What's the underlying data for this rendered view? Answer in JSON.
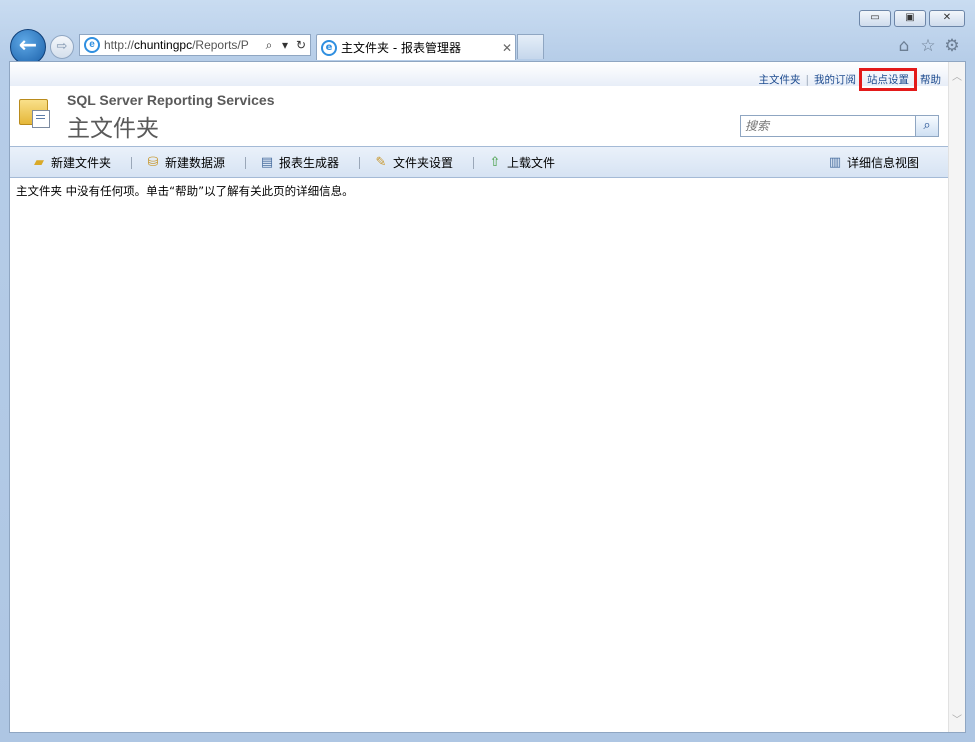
{
  "browser": {
    "address": {
      "prefix": "http://",
      "host": "chuntingpc",
      "path": "/Reports/P"
    },
    "tab_title": "主文件夹 - 报表管理器",
    "icons": [
      "back-arrow-icon",
      "forward-arrow-icon",
      "ie-logo-icon",
      "search-icon",
      "dropdown-icon",
      "refresh-icon",
      "close-icon",
      "home-icon",
      "star-icon",
      "gear-icon",
      "minimize-icon",
      "maximize-icon"
    ]
  },
  "toplinks": {
    "home": "主文件夹",
    "subscriptions": "我的订阅",
    "site_settings": "站点设置",
    "help": "帮助"
  },
  "header": {
    "product": "SQL Server Reporting Services",
    "title": "主文件夹",
    "search_placeholder": "搜索"
  },
  "toolbar": {
    "new_folder": "新建文件夹",
    "new_datasource": "新建数据源",
    "report_builder": "报表生成器",
    "folder_settings": "文件夹设置",
    "upload_file": "上载文件",
    "details_view": "详细信息视图"
  },
  "content": {
    "message": "主文件夹 中没有任何项。单击“帮助”以了解有关此页的详细信息。"
  },
  "colors": {
    "highlight": "#e31a1a",
    "link": "#1d4b8f",
    "toolbar_bg": "#dce7f5"
  }
}
